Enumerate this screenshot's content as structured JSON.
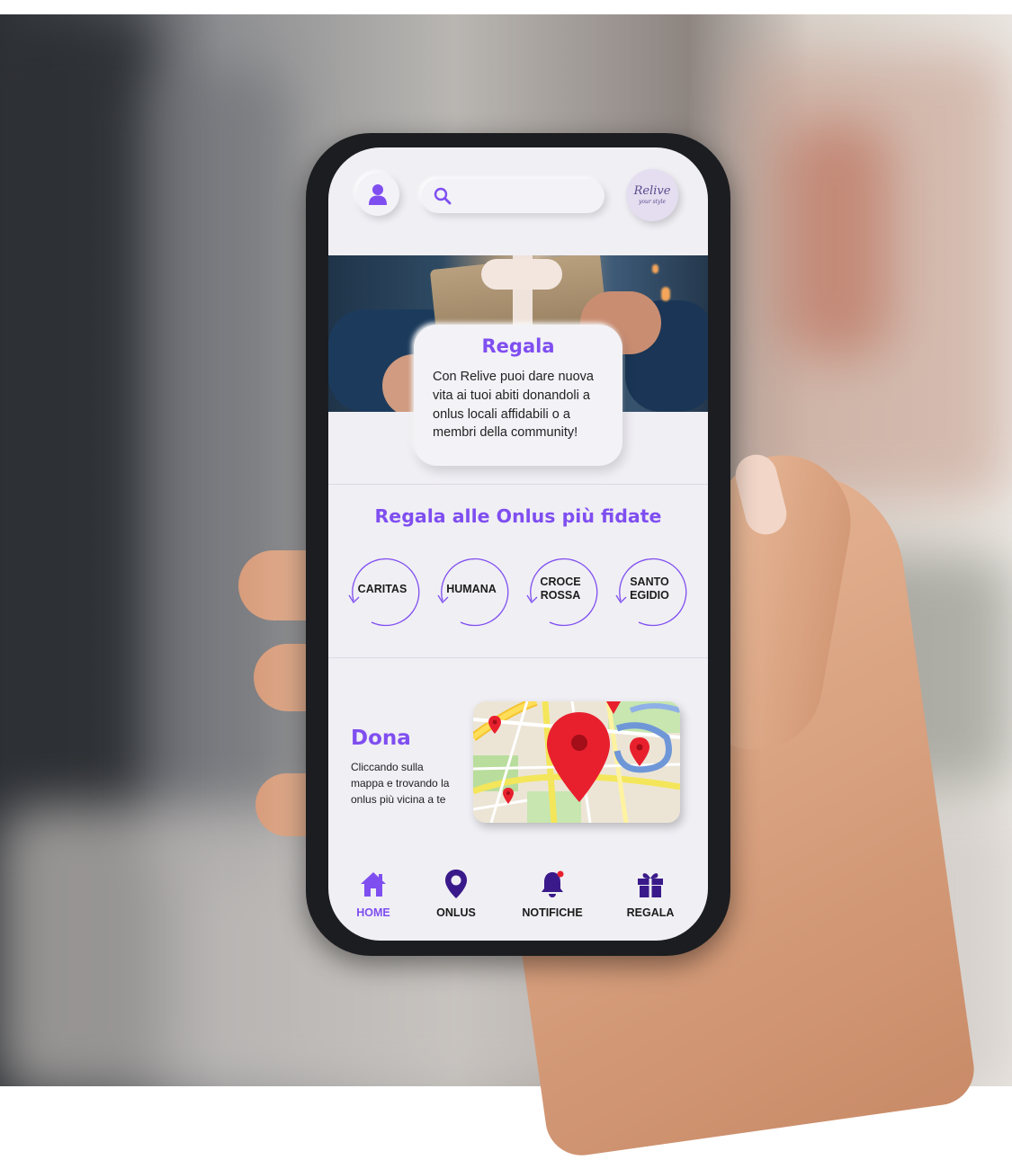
{
  "header": {
    "search": {
      "placeholder": ""
    },
    "logo": {
      "main": "Relive",
      "sub": "your style"
    }
  },
  "hero": {
    "title": "Regala",
    "text": "Con Relive puoi dare nuova vita ai tuoi abiti donandoli a onlus locali affidabili o a membri della community!"
  },
  "onlus_section": {
    "title": "Regala alle Onlus più fidate",
    "items": [
      {
        "label": "CARITAS"
      },
      {
        "label": "HUMANA"
      },
      {
        "label": "CROCE\nROSSA"
      },
      {
        "label": "SANTO\nEGIDIO"
      }
    ]
  },
  "dona": {
    "title": "Dona",
    "text": "Cliccando sulla mappa e trovando la onlus più vicina a te"
  },
  "bottom_nav": {
    "items": [
      {
        "label": "HOME",
        "icon": "home-icon",
        "active": true
      },
      {
        "label": "ONLUS",
        "icon": "location-pin-icon"
      },
      {
        "label": "NOTIFICHE",
        "icon": "bell-icon"
      },
      {
        "label": "REGALA",
        "icon": "gift-icon"
      }
    ]
  },
  "colors": {
    "accent": "#7f4ef0",
    "screen_bg": "#f0eff4",
    "nav_icon": "#3a1a8a",
    "map_pin": "#e8202e"
  }
}
